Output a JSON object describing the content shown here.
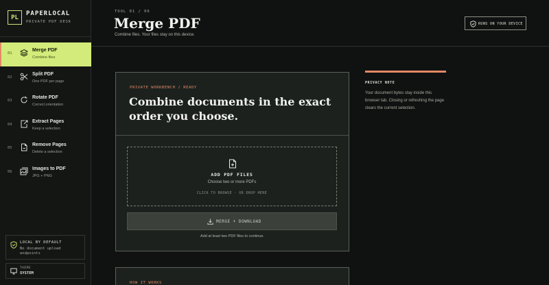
{
  "brand": {
    "logo": "PL",
    "name": "PAPERLOCAL",
    "subtitle": "PRIVATE PDF DESK"
  },
  "sidebar": {
    "items": [
      {
        "num": "01",
        "label": "Merge PDF",
        "sub": "Combine files",
        "icon": "layers-icon",
        "active": true
      },
      {
        "num": "02",
        "label": "Split PDF",
        "sub": "One PDF per page",
        "icon": "scissors-icon"
      },
      {
        "num": "03",
        "label": "Rotate PDF",
        "sub": "Correct orientation",
        "icon": "rotate-icon"
      },
      {
        "num": "04",
        "label": "Extract Pages",
        "sub": "Keep a selection",
        "icon": "extract-icon"
      },
      {
        "num": "05",
        "label": "Remove Pages",
        "sub": "Delete a selection",
        "icon": "file-minus-icon"
      },
      {
        "num": "06",
        "label": "Images to PDF",
        "sub": "JPG + PNG",
        "icon": "images-icon"
      }
    ],
    "local": {
      "title": "LOCAL BY DEFAULT",
      "desc": "No document upload endpoints"
    },
    "theme": {
      "title": "THEME",
      "value": "SYSTEM"
    }
  },
  "header": {
    "kicker": "TOOL 01 / 06",
    "title": "Merge PDF",
    "subtitle": "Combine files. Your files stay on this device.",
    "badge": "RUNS ON YOUR DEVICE"
  },
  "card": {
    "kicker": "PRIVATE WORKBENCH / READY",
    "heading": "Combine documents in the exact order you choose.",
    "dropzone": {
      "title": "ADD PDF FILES",
      "sub": "Choose two or more PDFs",
      "hint": "CLICK TO BROWSE · OR DROP HERE"
    },
    "button": "MERGE + DOWNLOAD",
    "hint": "Add at least two PDF files to continue."
  },
  "note": {
    "title": "PRIVACY NOTE",
    "body": "Your document bytes stay inside this browser tab. Closing or refreshing the page clears the current selection."
  },
  "card2": {
    "kicker": "HOW IT WORKS"
  },
  "colors": {
    "accent": "#d2eb7a",
    "highlight": "#e58a66",
    "background": "#101211"
  }
}
